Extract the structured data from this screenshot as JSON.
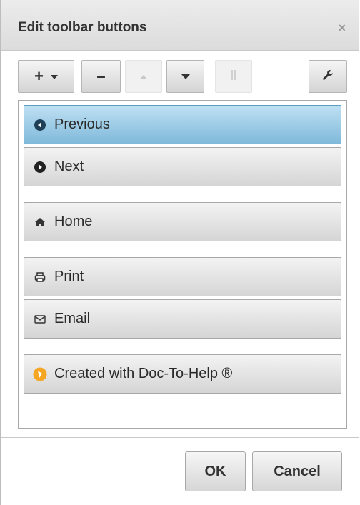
{
  "dialog": {
    "title": "Edit toolbar buttons",
    "close_label": "×"
  },
  "toolbar": {
    "add_label": "+",
    "remove_label": "–",
    "move_up_label": "▲",
    "move_down_label": "▼",
    "separator_label": "||",
    "settings_icon": "wrench-icon"
  },
  "items": [
    {
      "label": "Previous",
      "icon": "previous-circle-icon",
      "selected": true
    },
    {
      "label": "Next",
      "icon": "next-circle-icon",
      "selected": false
    },
    {
      "label": "Home",
      "icon": "home-icon",
      "selected": false
    },
    {
      "label": "Print",
      "icon": "print-icon",
      "selected": false
    },
    {
      "label": "Email",
      "icon": "email-icon",
      "selected": false
    },
    {
      "label": "Created with Doc-To-Help ®",
      "icon": "doc-to-help-logo-icon",
      "selected": false
    }
  ],
  "footer": {
    "ok_label": "OK",
    "cancel_label": "Cancel"
  },
  "colors": {
    "selected_top": "#bfe0f3",
    "selected_bottom": "#7fb9da",
    "logo_orange": "#f5a623"
  }
}
